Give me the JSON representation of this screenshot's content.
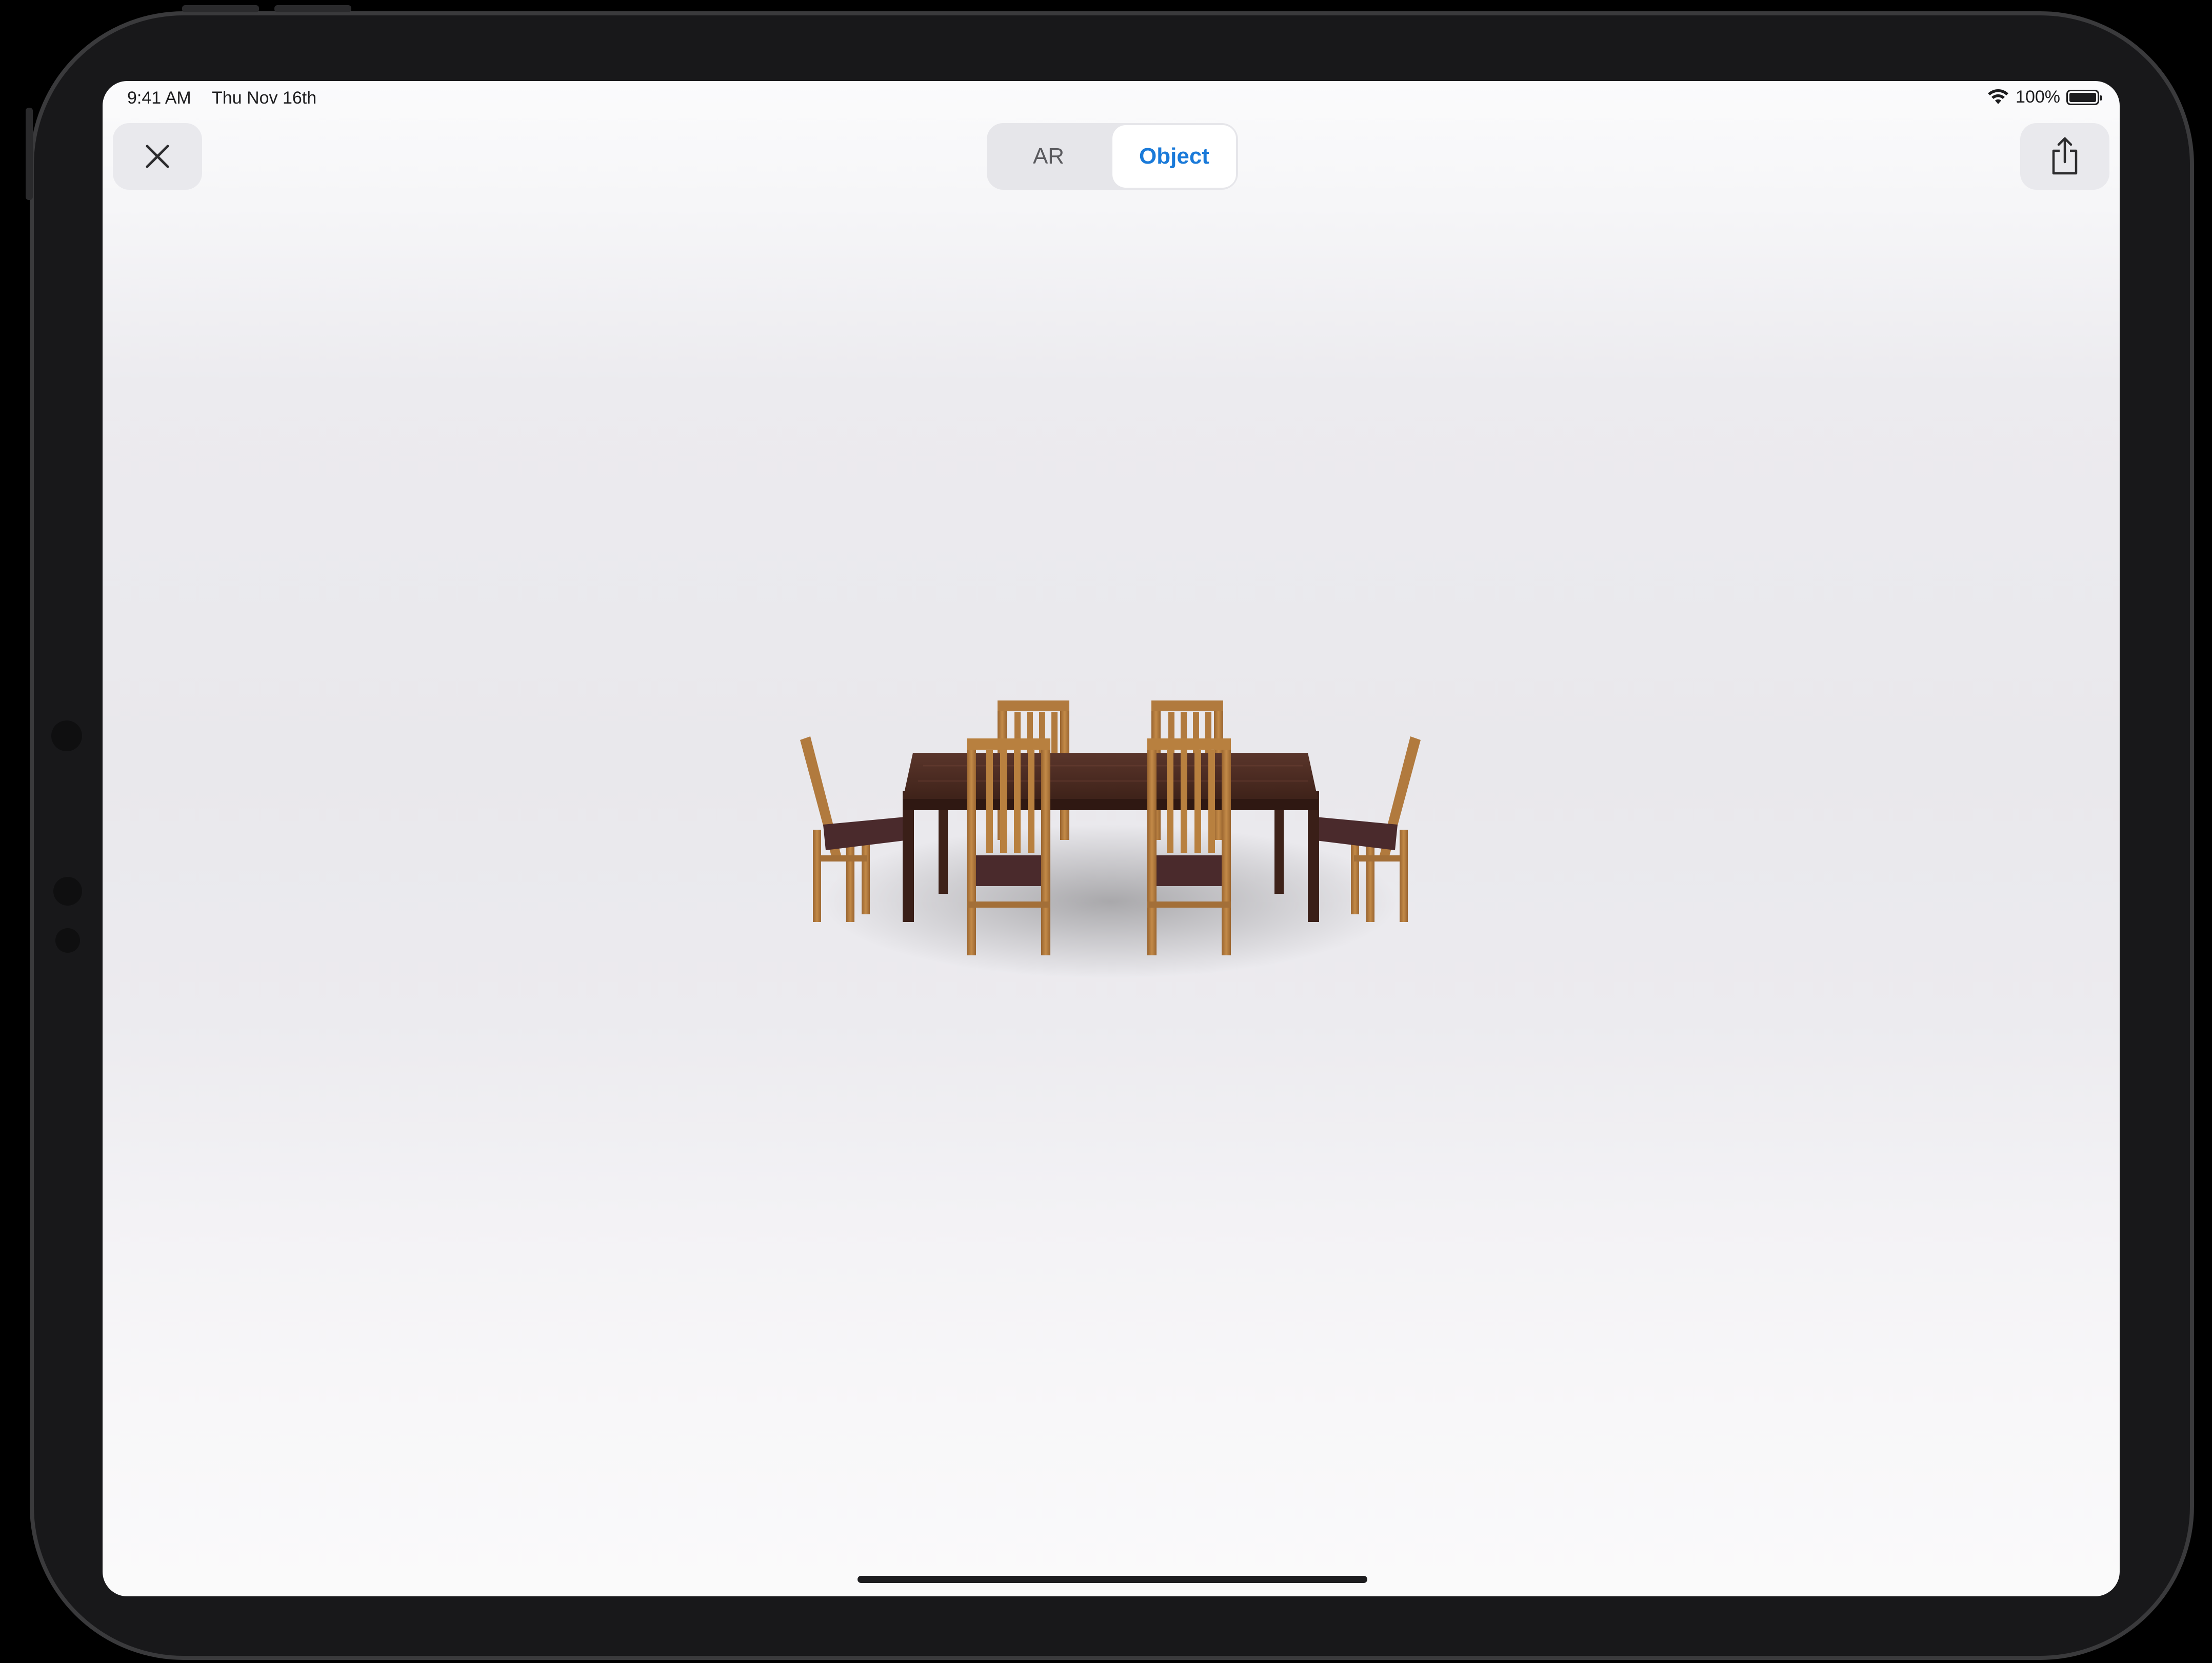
{
  "status_bar": {
    "time": "9:41 AM",
    "date": "Thu Nov 16th",
    "battery": "100%",
    "wifi_icon": "wifi-icon",
    "battery_icon": "battery-icon"
  },
  "toolbar": {
    "close_icon": "close-icon",
    "share_icon": "share-icon",
    "segments": [
      {
        "label": "AR",
        "selected": false
      },
      {
        "label": "Object",
        "selected": true
      }
    ]
  },
  "viewer": {
    "model": "dining-table-with-six-chairs"
  },
  "colors": {
    "accent": "#1a7ad9",
    "table_wood": "#4a2a22",
    "chair_wood": "#b07a3c",
    "seat_cushion": "#4a2a2c"
  }
}
